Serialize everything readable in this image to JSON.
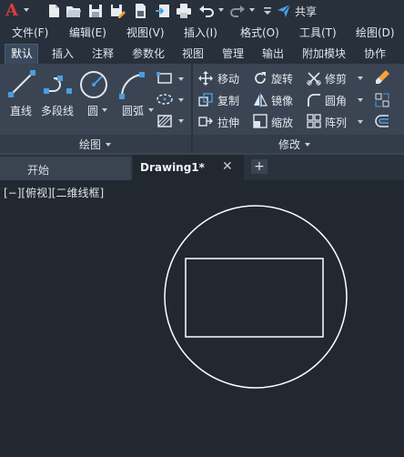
{
  "app": {
    "logo_letter": "A",
    "share_label": "共享"
  },
  "menu": {
    "items": [
      "文件(F)",
      "编辑(E)",
      "视图(V)",
      "插入(I)",
      "格式(O)",
      "工具(T)",
      "绘图(D)"
    ]
  },
  "ribbon_tabs": {
    "items": [
      "默认",
      "插入",
      "注释",
      "参数化",
      "视图",
      "管理",
      "输出",
      "附加模块",
      "协作"
    ],
    "active": "默认"
  },
  "draw_panel": {
    "title": "绘图",
    "tools": [
      "直线",
      "多段线",
      "圆",
      "圆弧"
    ]
  },
  "modify_panel": {
    "title": "修改",
    "tools": [
      "移动",
      "旋转",
      "修剪",
      "复制",
      "镜像",
      "圆角",
      "拉伸",
      "缩放",
      "阵列"
    ]
  },
  "doc_tabs": {
    "start": "开始",
    "drawing": "Drawing1*",
    "close": "✕",
    "add": "+"
  },
  "viewport": {
    "label": "[−][俯视][二维线框]"
  },
  "colors": {
    "background": "#212830",
    "ribbon": "#3b4453",
    "accent_red": "#e03b3b",
    "share_blue": "#4a9de0",
    "geometry": "#ffffff"
  }
}
